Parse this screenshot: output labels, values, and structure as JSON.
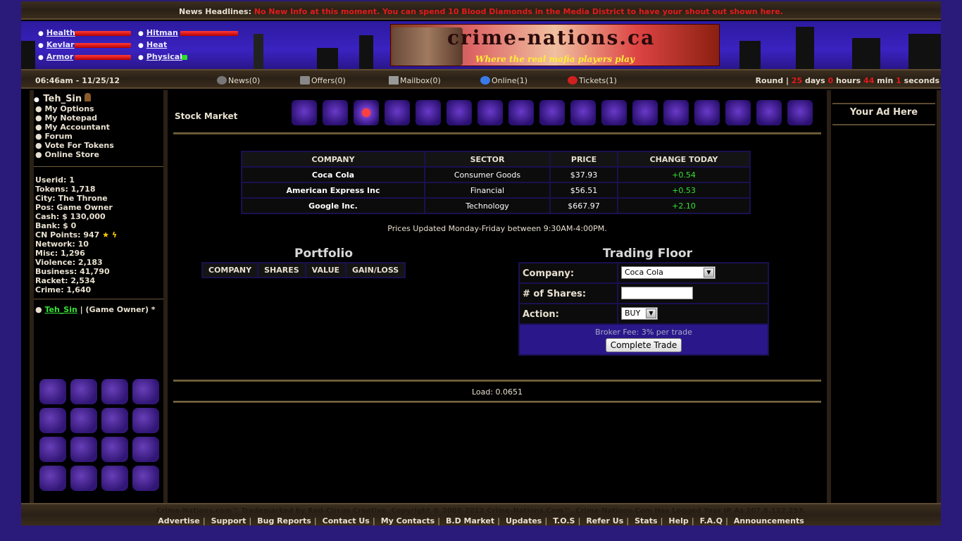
{
  "news": {
    "label": "News Headlines:",
    "message": "No New Info at this moment. You can spend 10 Blood Diamonds in the Media District to have your shout out shown here."
  },
  "stats": {
    "health": "Health",
    "kevlar": "Kevlar",
    "armor": "Armor",
    "hitman": "Hitman",
    "heat": "Heat",
    "physical": "Physical"
  },
  "logo": {
    "title": "crime-nations.ca",
    "tagline": "Where the real mafia players play"
  },
  "statusbar": {
    "time": "06:46am - 11/25/12",
    "news": "News(0)",
    "offers": "Offers(0)",
    "mailbox": "Mailbox(0)",
    "online": "Online(1)",
    "tickets": "Tickets(1)",
    "round_label": "Round",
    "days": "25",
    "days_lbl": "days",
    "hours": "0",
    "hours_lbl": "hours",
    "min": "44",
    "min_lbl": "min",
    "seconds": "1",
    "seconds_lbl": "seconds"
  },
  "user": {
    "name": "Teh_Sin",
    "links": [
      "My Options",
      "My Notepad",
      "My Accountant",
      "Forum",
      "Vote For Tokens",
      "Online Store"
    ],
    "info": [
      "Userid: 1",
      "Tokens: 1,718",
      "City: The Throne",
      "Pos: Game Owner",
      "Cash: $ 130,000",
      "Bank: $ 0",
      "CN Points: 947",
      "Network: 10",
      "Misc: 1,296",
      "Violence: 2,183",
      "Business: 41,790",
      "Racket: 2,534",
      "Crime: 1,640"
    ],
    "online_name": "Teh_Sin",
    "online_role": "| (Game Owner) *"
  },
  "page": {
    "title": "Stock Market"
  },
  "stocks": {
    "headers": [
      "COMPANY",
      "SECTOR",
      "PRICE",
      "CHANGE TODAY"
    ],
    "rows": [
      {
        "company": "Coca Cola",
        "sector": "Consumer Goods",
        "price": "$37.93",
        "change": "+0.54"
      },
      {
        "company": "American Express Inc",
        "sector": "Financial",
        "price": "$56.51",
        "change": "+0.53"
      },
      {
        "company": "Google Inc.",
        "sector": "Technology",
        "price": "$667.97",
        "change": "+2.10"
      }
    ],
    "note": "Prices Updated Monday-Friday between 9:30AM-4:00PM."
  },
  "portfolio": {
    "title": "Portfolio",
    "headers": [
      "COMPANY",
      "SHARES",
      "VALUE",
      "GAIN/LOSS"
    ]
  },
  "trading": {
    "title": "Trading Floor",
    "company_label": "Company:",
    "company_value": "Coca Cola",
    "shares_label": "# of Shares:",
    "shares_value": "",
    "action_label": "Action:",
    "action_value": "BUY",
    "fee": "Broker Fee: 3% per trade",
    "submit": "Complete Trade"
  },
  "load": "Load: 0.0651",
  "ad": {
    "title": "Your Ad Here"
  },
  "footer": {
    "copyright": "Crime-Nations.com™ Trademarked by Red-Circus Creative. Copyright © 2008-2012 Crime-Nations.Com™. Crime-Nations.Com Has Logged Your IP As 207.6.122.253.",
    "links": [
      "Advertise",
      "Support",
      "Bug Reports",
      "Contact Us",
      "My Contacts",
      "B.D Market",
      "Updates",
      "T.O.S",
      "Refer Us",
      "Stats",
      "Help",
      "F.A.Q",
      "Announcements"
    ]
  }
}
